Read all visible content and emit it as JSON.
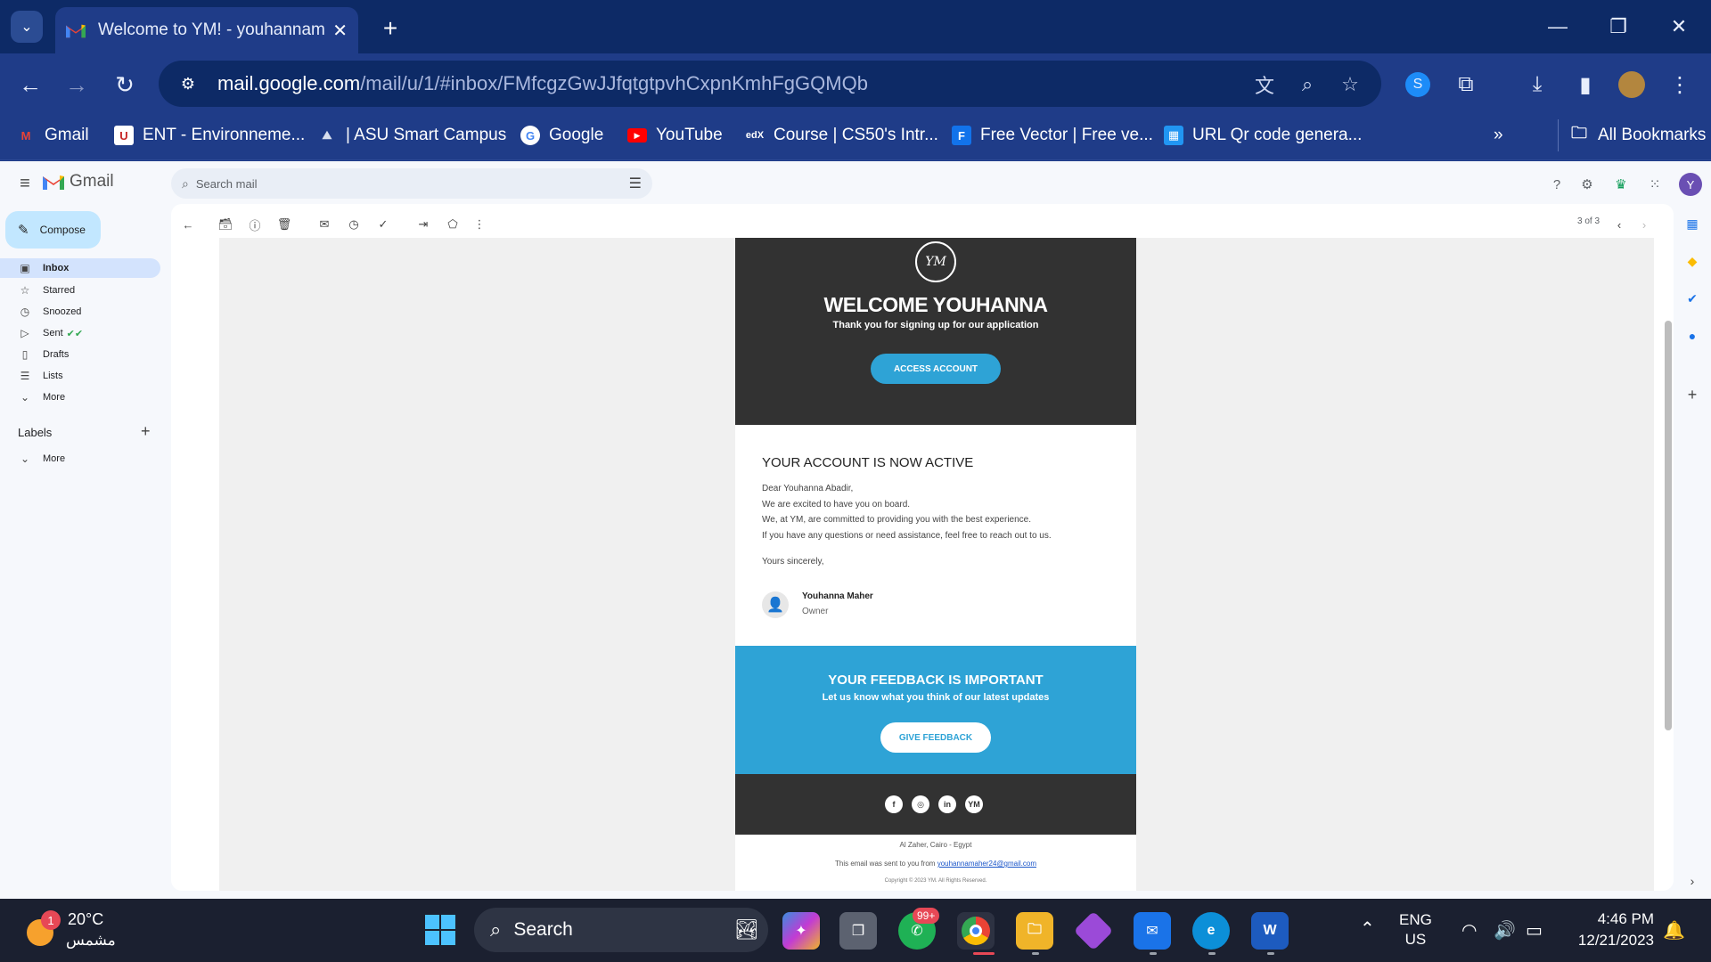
{
  "browser": {
    "tab_title": "Welcome to YM! - youhannama",
    "url_host": "mail.google.com",
    "url_path": "/mail/u/1/#inbox/FMfcgzGwJJfqtgtpvhCxpnKmhFgGQMQb",
    "bookmarks": [
      {
        "label": "Gmail",
        "icon": "gmail-icon",
        "color": "#ea4335"
      },
      {
        "label": "ENT - Environneme...",
        "icon": "ent-icon",
        "color": "#c62828"
      },
      {
        "label": "| ASU Smart Campus",
        "icon": "asu-icon",
        "color": "#8fa6c9"
      },
      {
        "label": "Google",
        "icon": "google-icon",
        "color": "#4285f4"
      },
      {
        "label": "YouTube",
        "icon": "youtube-icon",
        "color": "#ff0000"
      },
      {
        "label": "Course | CS50's Intr...",
        "icon": "edx-icon",
        "color": "#ffffff"
      },
      {
        "label": "Free Vector | Free ve...",
        "icon": "freepik-icon",
        "color": "#1273eb"
      },
      {
        "label": "URL Qr code genera...",
        "icon": "qr-icon",
        "color": "#2196f3"
      }
    ],
    "all_bookmarks": "All Bookmarks"
  },
  "gmail": {
    "brand": "Gmail",
    "search_placeholder": "Search mail",
    "compose": "Compose",
    "nav": [
      {
        "label": "Inbox",
        "icon": "inbox-icon"
      },
      {
        "label": "Starred",
        "icon": "star-icon"
      },
      {
        "label": "Snoozed",
        "icon": "clock-icon"
      },
      {
        "label": "Sent",
        "icon": "send-icon"
      },
      {
        "label": "Drafts",
        "icon": "draft-icon"
      },
      {
        "label": "Lists",
        "icon": "list-icon"
      },
      {
        "label": "More",
        "icon": "chevron-down-icon"
      }
    ],
    "labels_title": "Labels",
    "labels_more": "More",
    "page_count": "3 of 3",
    "avatar_letter": "Y"
  },
  "email": {
    "logo": "YM",
    "welcome": "WELCOME YOUHANNA",
    "thanks": "Thank you for signing up for our application",
    "access_button": "ACCESS ACCOUNT",
    "active_title": "YOUR ACCOUNT IS NOW ACTIVE",
    "body_lines": [
      "Dear Youhanna Abadir,",
      "We are excited to have you on board.",
      "We, at YM, are committed to providing you with the best experience.",
      "If you have any questions or need assistance, feel free to reach out to us."
    ],
    "sincerely": "Yours sincerely,",
    "sig_name": "Youhanna Maher",
    "sig_role": "Owner",
    "feedback_title": "YOUR FEEDBACK IS IMPORTANT",
    "feedback_sub": "Let us know what you think of our latest updates",
    "feedback_button": "GIVE FEEDBACK",
    "address": "Al Zaher, Cairo - Egypt",
    "sent_prefix": "This email was sent to you from",
    "sent_email": "youhannamaher24@gmail.com",
    "copyright": "Copyright © 2023 YM. All Rights Reserved."
  },
  "taskbar": {
    "weather_badge": "1",
    "temperature": "20°C",
    "condition": "مشمس",
    "search": "Search",
    "whatsapp_badge": "99+",
    "lang_1": "ENG",
    "lang_2": "US",
    "time": "4:46 PM",
    "date": "12/21/2023"
  },
  "colors": {
    "chrome_dark": "#0d2a66",
    "chrome": "#1f3c88",
    "email_dark": "#323232",
    "email_accent": "#2ea3d6"
  }
}
